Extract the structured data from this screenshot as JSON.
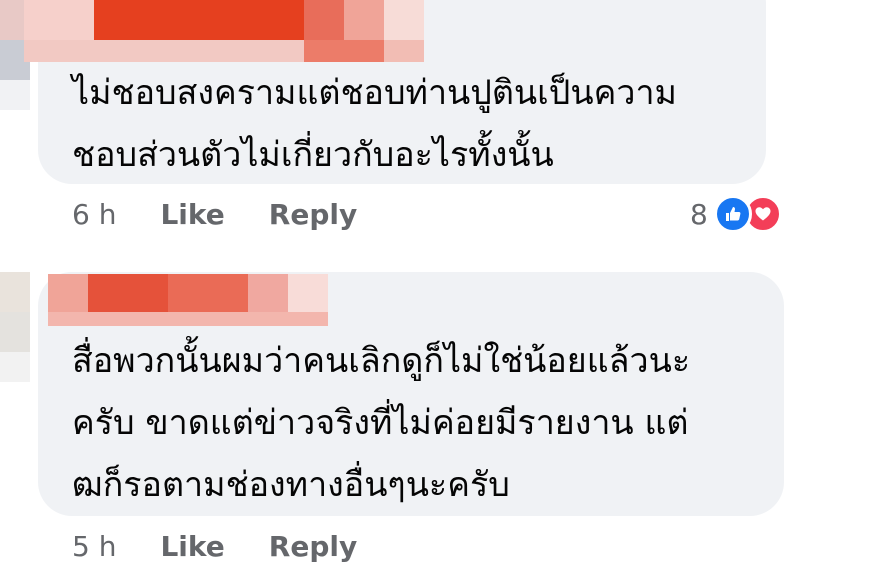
{
  "comments": [
    {
      "text_line1": "ไม่ชอบสงครามแต่ชอบท่านปูตินเป็นความ",
      "text_line2": "ชอบส่วนตัวไม่เกี่ยวกับอะไรทั้งนั้น",
      "time": "6 h",
      "like_label": "Like",
      "reply_label": "Reply",
      "reaction_count": "8",
      "reactions": [
        "like-icon",
        "love-icon"
      ]
    },
    {
      "text_line1": "สื่อพวกนั้นผมว่าคนเลิกดูก็ไม่ใช่น้อยแล้วนะ",
      "text_line2": "ครับ ขาดแต่ข่าวจริงที่ไม่ค่อยมีรายงาน แต่",
      "text_line3": "ฒก็รอตามช่องทางอื่นๆนะครับ",
      "time": "5 h",
      "like_label": "Like",
      "reply_label": "Reply"
    }
  ],
  "colors": {
    "bubble_bg": "#f0f2f5",
    "meta_text": "#65676b",
    "like_blue": "#1877f2",
    "love_red": "#f33e58"
  }
}
